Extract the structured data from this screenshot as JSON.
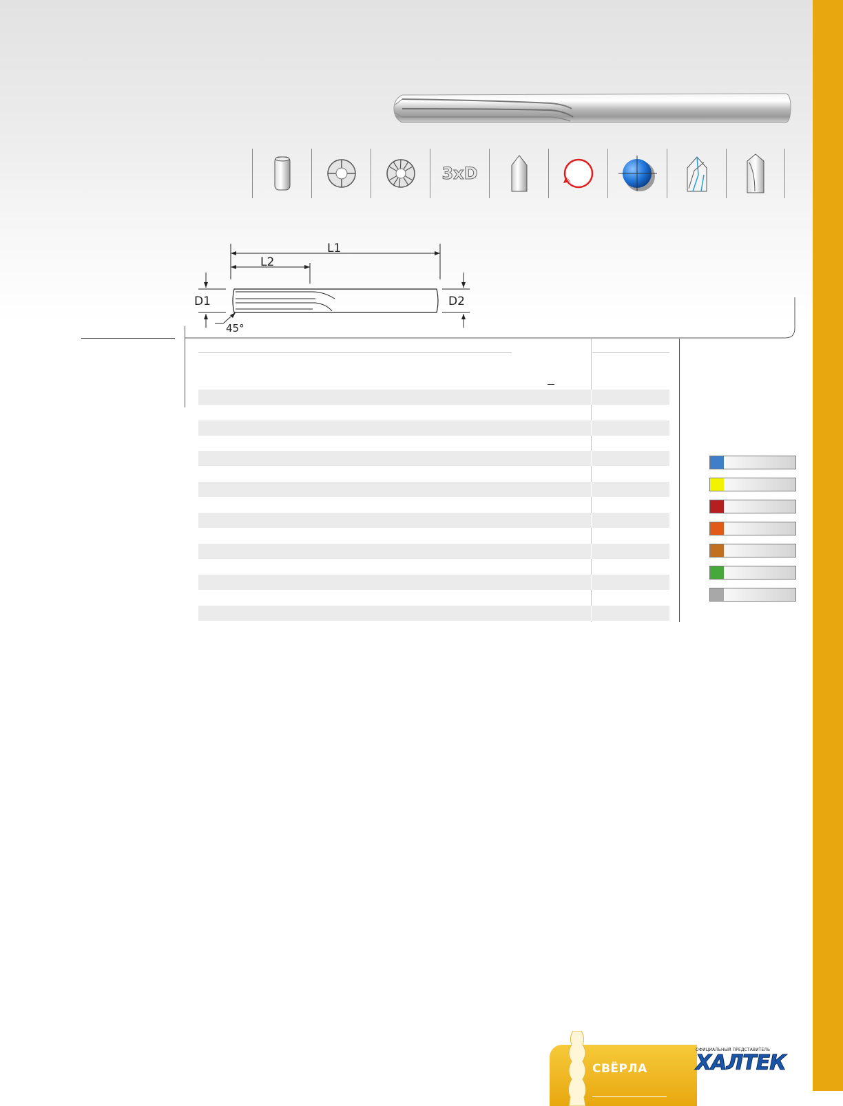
{
  "drawing": {
    "label_l1": "L1",
    "label_l2": "L2",
    "label_d1": "D1",
    "label_d2": "D2",
    "label_angle": "45°"
  },
  "icon_strip": {
    "icons": [
      "shank-icon",
      "straight-flute-section-icon",
      "helical-flute-section-icon",
      "depth-3xd-icon",
      "pointed-tip-icon",
      "rotation-direction-icon",
      "coolant-coating-icon",
      "helix-angle-icon",
      "straight-flute-icon"
    ],
    "depth_label": "3xD"
  },
  "table": {
    "stripe_rows": 8
  },
  "legend": {
    "colors": [
      "#3f7ec8",
      "#f2f201",
      "#b51f1f",
      "#e05a18",
      "#c07020",
      "#46a83a",
      "#a8a8a8"
    ]
  },
  "footer": {
    "section_label": "СВЁРЛА",
    "logo_caption": "ОФИЦИАЛЬНЫЙ ПРЕДСТАВИТЕЛЬ",
    "logo_name": "ХАЛТЕК"
  },
  "colors": {
    "accent": "#e8a70f",
    "logo_blue": "#1b55a8"
  }
}
